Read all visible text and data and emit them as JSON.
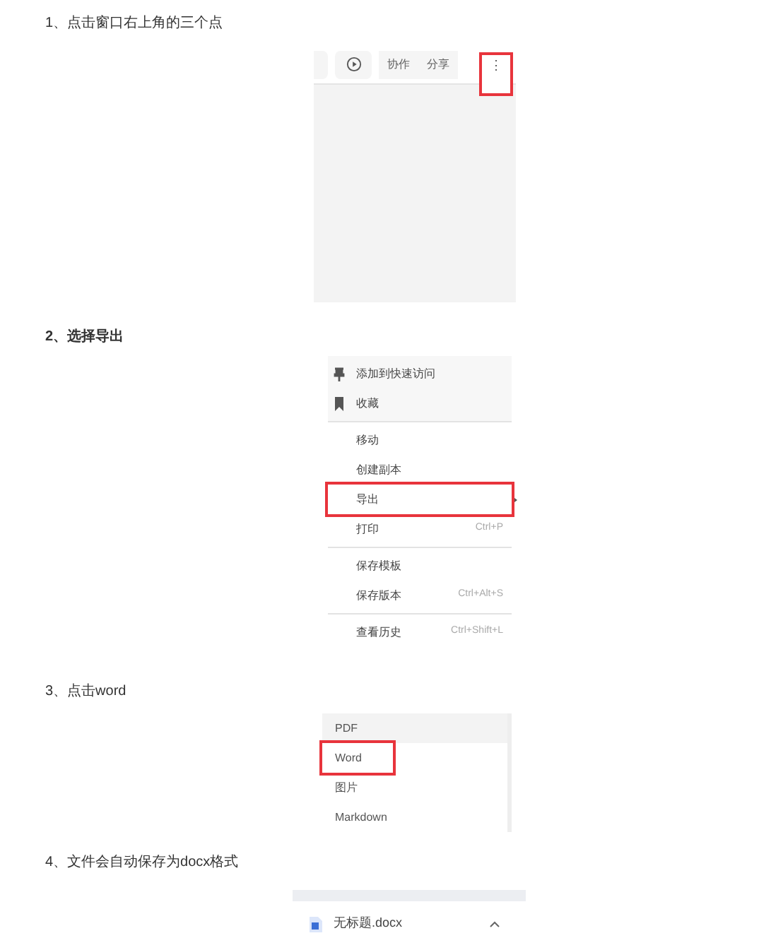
{
  "steps": [
    {
      "kind": "toolbar",
      "caption": "1、点击窗口右上角的三个点",
      "bold": false,
      "buttons": [
        {
          "label": "协作",
          "highlighted": false
        },
        {
          "label": "分享",
          "highlighted": false
        }
      ],
      "more": {
        "label": "⋮",
        "highlighted": true
      }
    },
    {
      "kind": "menu",
      "caption": "2、选择导出",
      "bold": true,
      "groups": [
        {
          "shaded": true,
          "items": [
            {
              "label": "添加到快速访问",
              "highlighted": false,
              "submenu": false
            },
            {
              "label": "收藏",
              "highlighted": false,
              "submenu": false
            }
          ]
        },
        {
          "shaded": false,
          "items": [
            {
              "label": "移动",
              "highlighted": false,
              "submenu": false
            },
            {
              "label": "创建副本",
              "highlighted": false,
              "submenu": false
            },
            {
              "label": "导出",
              "highlighted": true,
              "submenu": true
            },
            {
              "label": "打印",
              "shortcut": "Ctrl+P",
              "highlighted": false,
              "submenu": false
            }
          ]
        },
        {
          "shaded": false,
          "items": [
            {
              "label": "保存模板",
              "highlighted": false,
              "submenu": false
            },
            {
              "label": "保存版本",
              "shortcut": "Ctrl+Alt+S",
              "highlighted": false,
              "submenu": false
            }
          ]
        },
        {
          "shaded": false,
          "items": [
            {
              "label": "查看历史",
              "shortcut": "Ctrl+Shift+L",
              "highlighted": false,
              "submenu": false
            }
          ]
        }
      ]
    },
    {
      "kind": "list",
      "caption": "3、点击word",
      "bold": false,
      "items": [
        {
          "label": "PDF",
          "hovered": true,
          "highlighted": false
        },
        {
          "label": "Word",
          "hovered": false,
          "highlighted": true
        },
        {
          "label": "图片",
          "hovered": false,
          "highlighted": false
        },
        {
          "label": "Markdown",
          "hovered": false,
          "highlighted": false
        }
      ]
    },
    {
      "kind": "download",
      "caption": "4、文件会自动保存为docx格式",
      "bold": false,
      "file": "无标题.docx"
    }
  ]
}
